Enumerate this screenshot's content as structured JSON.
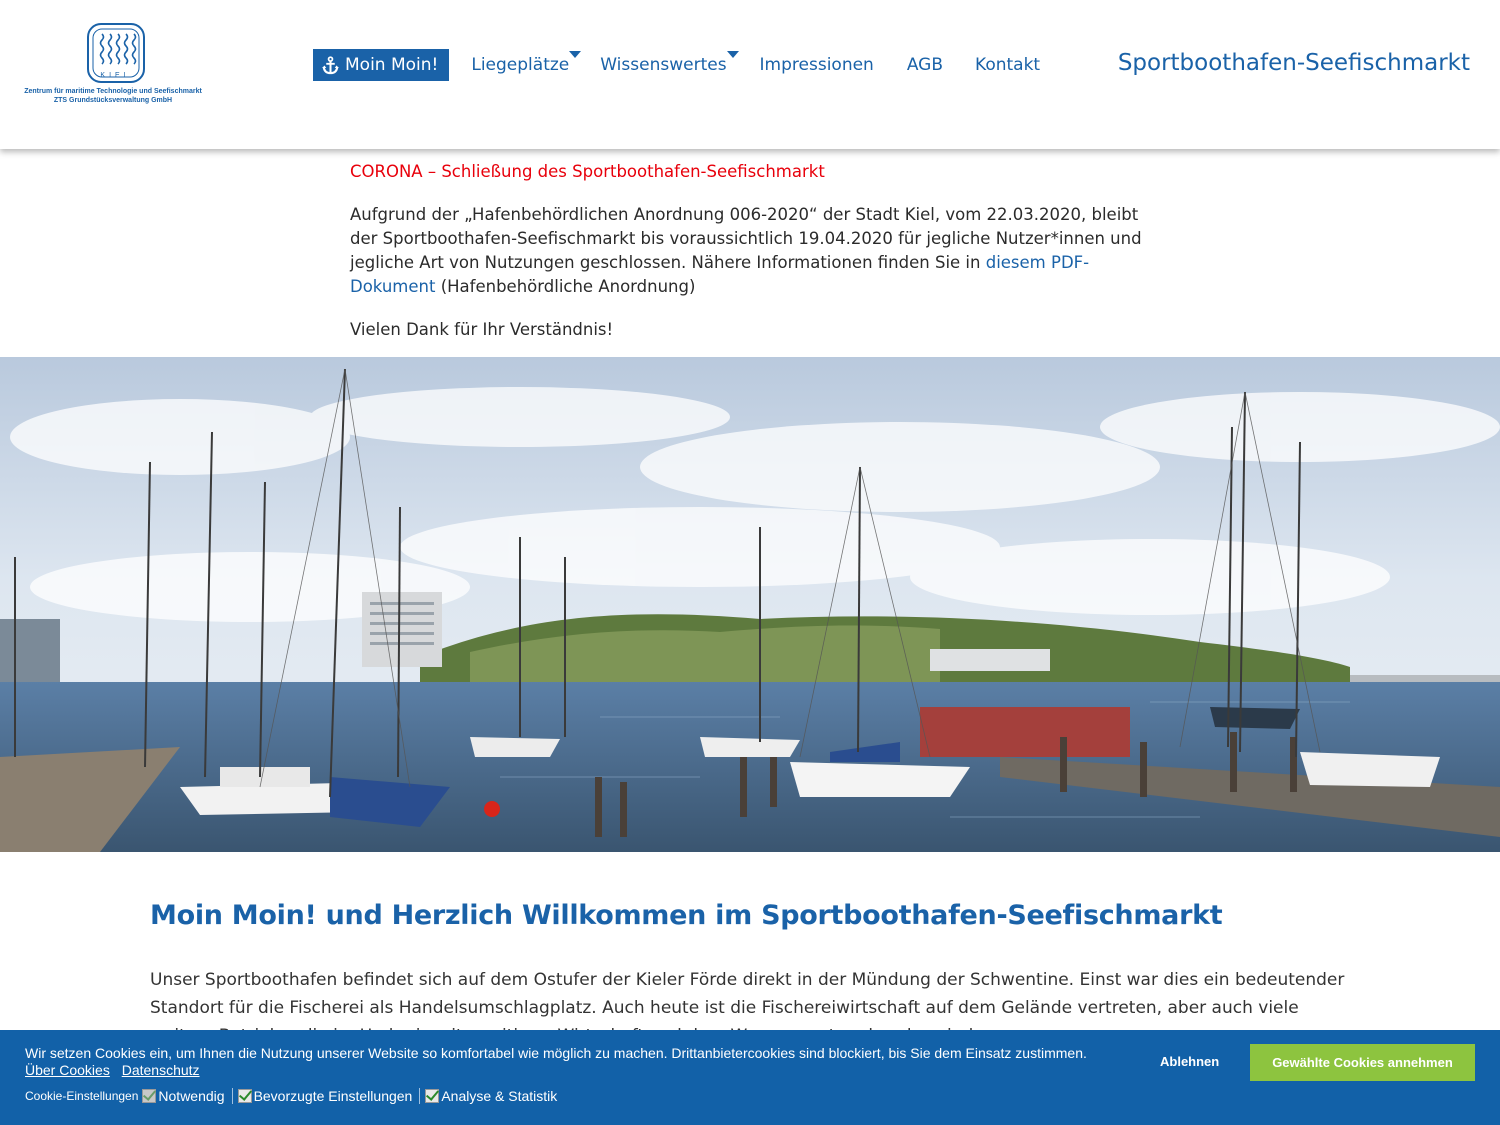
{
  "logo": {
    "emblem_text": "KIEL",
    "line1": "Zentrum für maritime Technologie und Seefischmarkt",
    "line2": "ZTS Grundstücksverwaltung GmbH"
  },
  "nav": {
    "items": [
      {
        "label": "Moin Moin!",
        "icon": "anchor-icon",
        "active": true
      },
      {
        "label": "Liegeplätze",
        "has_dropdown": true
      },
      {
        "label": "Wissenswertes",
        "has_dropdown": true
      },
      {
        "label": "Impressionen"
      },
      {
        "label": "AGB"
      },
      {
        "label": "Kontakt"
      }
    ]
  },
  "site_title": "Sportboothafen-Seefischmarkt",
  "notice": {
    "title": "CORONA – Schließung des Sportboothafen-Seefischmarkt",
    "para_before_link": "Aufgrund der „Hafenbehördlichen Anordnung 006-2020“ der Stadt Kiel, vom 22.03.2020, bleibt der Sportboothafen-Seefischmarkt bis voraussichtlich 19.04.2020 für jegliche Nutzer*innen und jegliche Art von Nutzungen geschlossen. Nähere Informationen finden Sie in ",
    "link_text": "diesem PDF-Dokument",
    "para_after_link": " (Hafenbehördliche Anordnung)",
    "thanks": "Vielen Dank für Ihr Verständnis!"
  },
  "hero": {
    "alt": "marina-photo"
  },
  "welcome": {
    "title": "Moin Moin! und Herzlich Willkommen im Sportboothafen-Seefischmarkt",
    "text": "Unser Sportboothafen befindet sich auf dem Ostufer der Kieler Förde direkt in der Mündung der Schwentine. Einst war dies ein bedeutender Standort für die Fischerei als Handelsumschlagplatz. Auch heute ist die Fischereiwirtschaft auf dem Gelände vertreten, aber auch viele weitere Betriebe, die im Umkreis mit maritimer Wirtschaft und dem Wassersport verbunden sind."
  },
  "cookie": {
    "message": "Wir setzen Cookies ein, um Ihnen die Nutzung unserer Website so komfortabel wie möglich zu machen. Drittanbietercookies sind blockiert, bis Sie dem Einsatz zustimmen.",
    "link_about": "Über Cookies",
    "link_privacy": "Datenschutz",
    "settings_label": "Cookie-Einstellungen",
    "options": [
      {
        "label": "Notwendig",
        "checked": true,
        "disabled": true
      },
      {
        "label": "Bevorzugte Einstellungen",
        "checked": true
      },
      {
        "label": "Analyse & Statistik",
        "checked": true
      }
    ],
    "decline_label": "Ablehnen",
    "accept_label": "Gewählte Cookies annehmen"
  },
  "colors": {
    "brand_blue": "#1a62a8",
    "alert_red": "#e8000b",
    "cookie_bar": "#1261a8",
    "accept_green": "#8dc43f"
  }
}
